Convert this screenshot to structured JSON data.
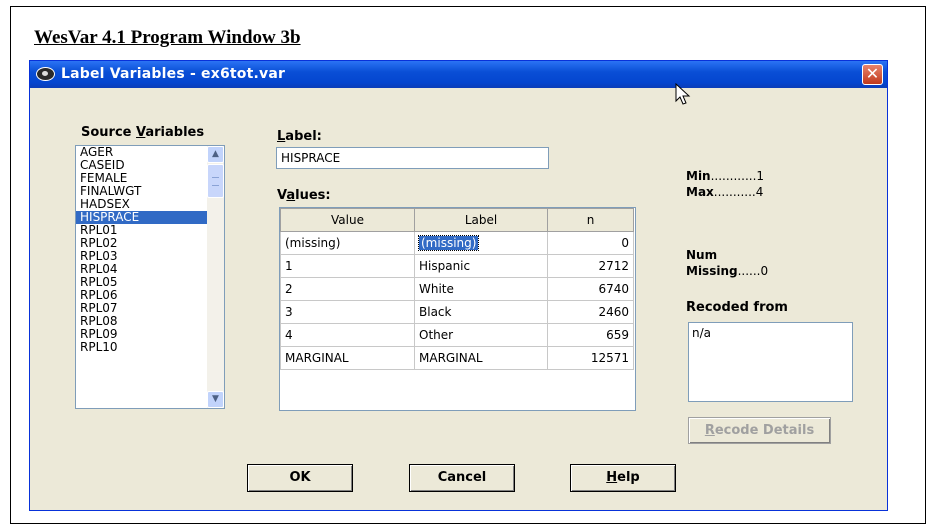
{
  "doc_title": "WesVar 4.1 Program Window 3b",
  "window": {
    "title": "Label Variables - ex6tot.var",
    "close_glyph": "✕"
  },
  "source": {
    "heading_pre": "Source ",
    "heading_key": "V",
    "heading_post": "ariables",
    "items": [
      "AGER",
      "CASEID",
      "FEMALE",
      "FINALWGT",
      "HADSEX",
      "HISPRACE",
      "RPL01",
      "RPL02",
      "RPL03",
      "RPL04",
      "RPL05",
      "RPL06",
      "RPL07",
      "RPL08",
      "RPL09",
      "RPL10"
    ],
    "selected": "HISPRACE"
  },
  "label_field": {
    "caption_key": "L",
    "caption_rest": "abel:",
    "value": "HISPRACE"
  },
  "values": {
    "caption_pre": "V",
    "caption_key": "a",
    "caption_post": "lues:",
    "columns": [
      "Value",
      "Label",
      "n"
    ],
    "rows": [
      {
        "value": "(missing)",
        "label": "(missing)",
        "n": "0"
      },
      {
        "value": "1",
        "label": "Hispanic",
        "n": "2712"
      },
      {
        "value": "2",
        "label": "White",
        "n": "6740"
      },
      {
        "value": "3",
        "label": "Black",
        "n": "2460"
      },
      {
        "value": "4",
        "label": "Other",
        "n": "659"
      },
      {
        "value": "MARGINAL",
        "label": "MARGINAL",
        "n": "12571"
      }
    ]
  },
  "stats": {
    "min_label": "Min",
    "min_dots": "............",
    "min_value": "1",
    "max_label": "Max",
    "max_dots": "...........",
    "max_value": "4",
    "num_label": "Num",
    "missing_label": "Missing",
    "missing_dots": "......",
    "missing_value": "0"
  },
  "recoded": {
    "heading": "Recoded from",
    "value": "n/a"
  },
  "buttons": {
    "recode_key": "R",
    "recode_rest": "ecode Details",
    "ok": "OK",
    "cancel": "Cancel",
    "help_key": "H",
    "help_rest": "elp"
  }
}
